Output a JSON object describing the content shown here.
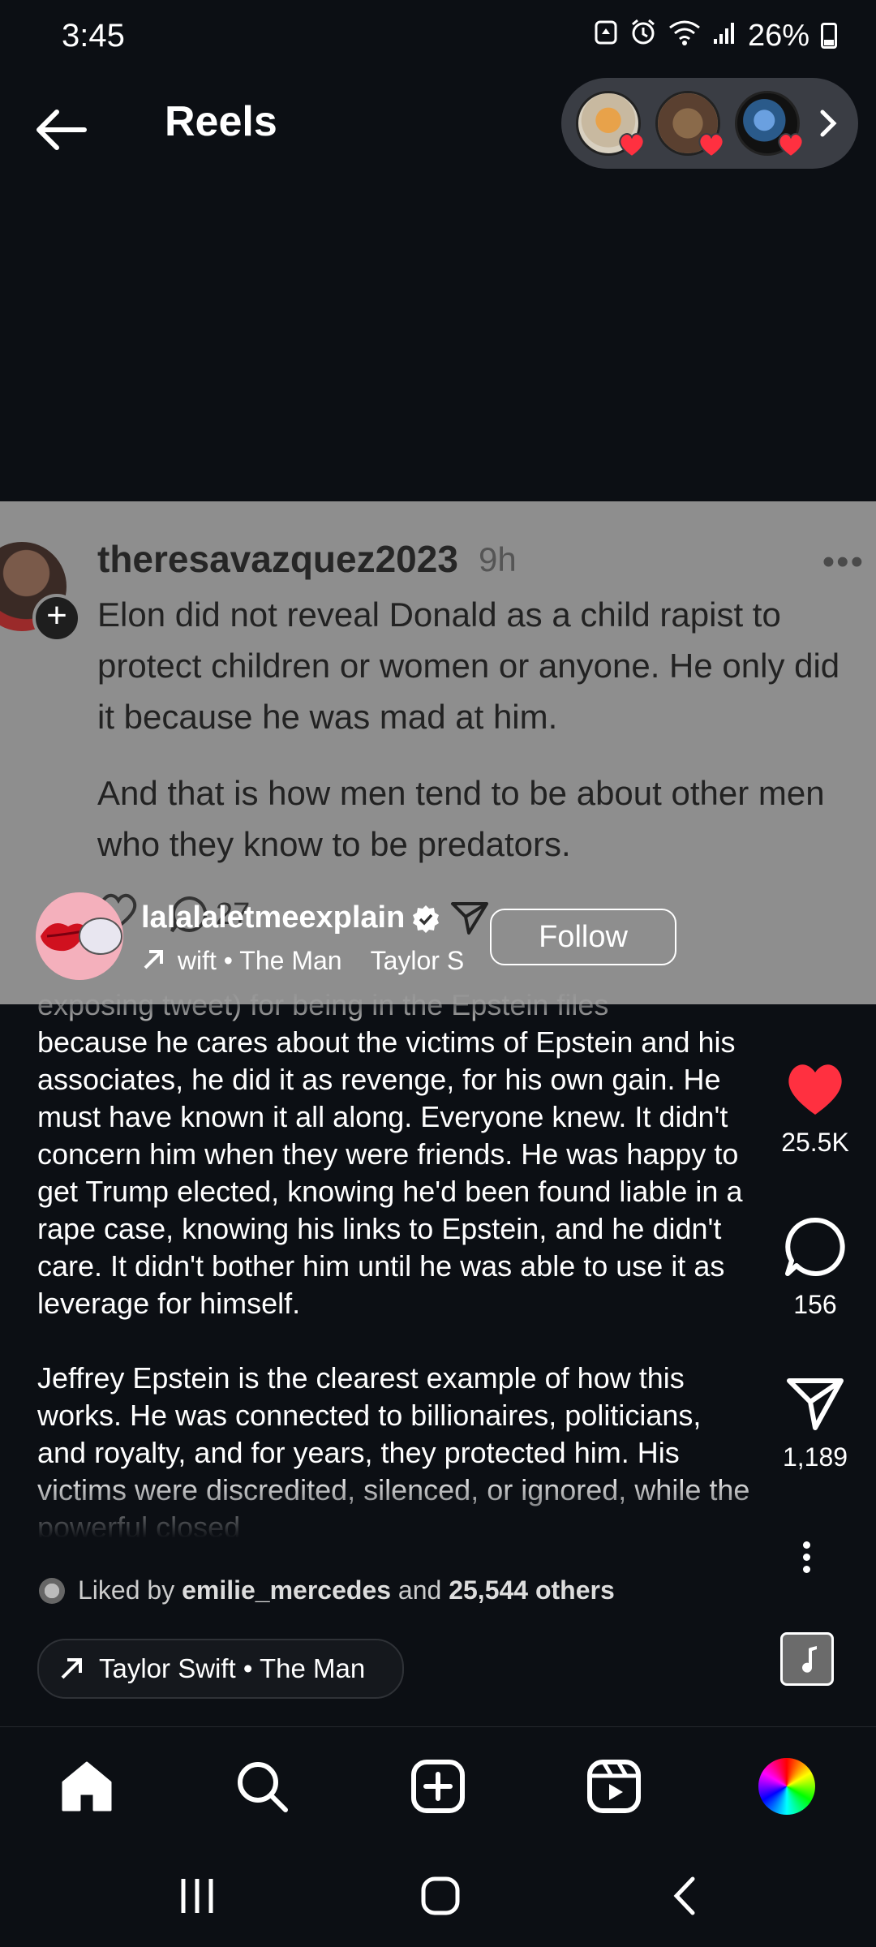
{
  "status_bar": {
    "time": "3:45",
    "battery": "26%"
  },
  "header": {
    "title": "Reels",
    "story_avatar_icons": [
      "story-avatar-flame",
      "story-avatar-plants",
      "story-avatar-dark"
    ]
  },
  "post_overlay": {
    "username": "theresavazquez2023",
    "time": "9h",
    "paragraph_1": "Elon did not reveal Donald as a child rapist to protect children or women or anyone. He only did it because he was mad at him.",
    "paragraph_2": "And that is how men tend to be about other men who they know to be predators.",
    "comment_count": "27"
  },
  "reel": {
    "creator": "lalalaletmeexplain",
    "audio_short": "wift • The Man    Taylor S",
    "follow_label": "Follow",
    "caption_lines": [
      "exposing tweet) for being in the Epstein files",
      "because he cares about the victims of Epstein and his associates, he did it as revenge, for his own gain. He must have known it all along. Everyone knew. It didn't concern him when they were friends. He was happy to get Trump elected, knowing he'd been found liable in a rape case, knowing his links to Epstein, and he didn't care. It didn't bother him until he was able to use it as leverage for himself.",
      "Jeffrey Epstein is the clearest example of how this works. He was connected to billionaires, politicians, and royalty, and for years, they protected him. His victims were discredited, silenced, or ignored, while the powerful closed"
    ],
    "like_count": "25.5K",
    "comment_count": "156",
    "share_count": "1,189",
    "liked_by_prefix": "Liked by",
    "liked_by_user": "emilie_mercedes",
    "liked_by_and": "and",
    "liked_by_others": "25,544 others",
    "audio_label": "Taylor Swift • The Man"
  },
  "colors": {
    "background": "#0c0f14",
    "like_red": "#ff3040",
    "overlay_grey": "#8e8e8e"
  }
}
